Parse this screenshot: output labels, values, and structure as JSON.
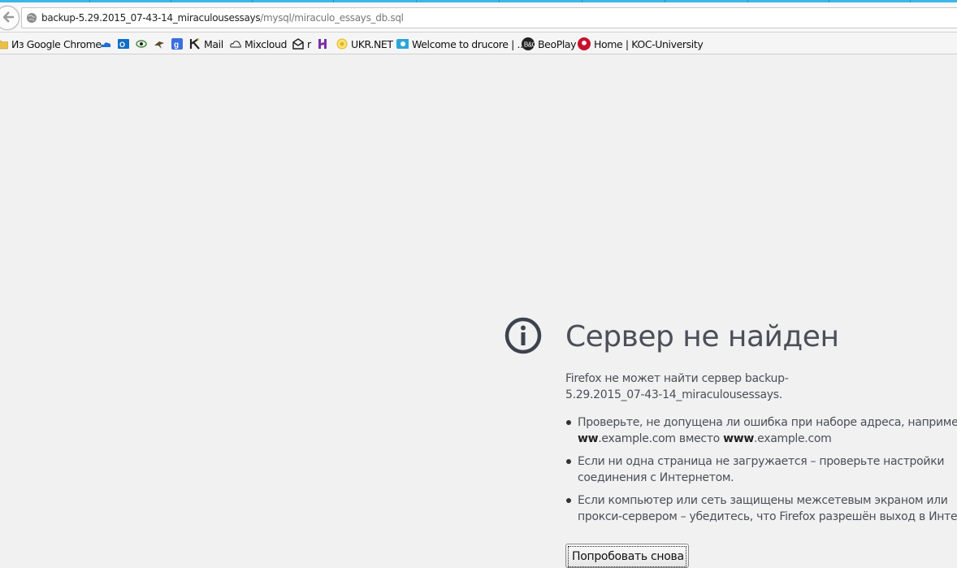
{
  "browser": {
    "url_host": "backup-5.29.2015_07-43-14_miraculousessays",
    "url_path": "/mysql/miraculo_essays_db.sql"
  },
  "bookmarks": [
    {
      "label": "Из Google Chrome",
      "icon": "folder-icon",
      "color": "#e8c04a"
    },
    {
      "label": "",
      "icon": "onedrive-icon",
      "color": "#1f6fd1"
    },
    {
      "label": "",
      "icon": "outlook-icon",
      "color": "#0f6fc6"
    },
    {
      "label": "",
      "icon": "eye-icon",
      "color": "#3a8a3a"
    },
    {
      "label": "",
      "icon": "bird-icon",
      "color": "#5a4a2a"
    },
    {
      "label": "",
      "icon": "google-plus-icon",
      "color": "#3b6fe0"
    },
    {
      "label": "Mail",
      "icon": "k-icon",
      "color": "#222222"
    },
    {
      "label": "Mixcloud",
      "icon": "cloud-icon",
      "color": "#444444"
    },
    {
      "label": "r",
      "icon": "envelope-icon",
      "color": "#222222"
    },
    {
      "label": "",
      "icon": "h-icon",
      "color": "#7b2fa8"
    },
    {
      "label": "UKR.NET",
      "icon": "ukrnet-icon",
      "color": "#f0c419"
    },
    {
      "label": "Welcome to drucore | ...",
      "icon": "drupal-icon",
      "color": "#2ba6d8"
    },
    {
      "label": "BeoPlay",
      "icon": "beoplay-icon",
      "color": "#222222"
    },
    {
      "label": "Home | KOC-University",
      "icon": "koc-icon",
      "color": "#c8102e"
    }
  ],
  "error": {
    "title": "Сервер не найден",
    "description": "Firefox не может найти сервер backup-5.29.2015_07-43-14_miraculousessays.",
    "items": [
      {
        "line1": "Проверьте, не допущена ли ошибка при наборе адреса, например",
        "line2_bold1": "ww",
        "line2_text1": ".example.com вместо ",
        "line2_bold2": "www",
        "line2_text2": ".example.com"
      },
      {
        "line1": "Если ни одна страница не загружается – проверьте настройки",
        "line2": "соединения с Интернетом."
      },
      {
        "line1": "Если компьютер или сеть защищены межсетевым экраном или",
        "line2": "прокси-сервером – убедитесь, что Firefox разрешён выход в Интер"
      }
    ],
    "retry_label": "Попробовать снова"
  },
  "colors": {
    "accent": "#3fb6e8",
    "title": "#4a4f58"
  }
}
